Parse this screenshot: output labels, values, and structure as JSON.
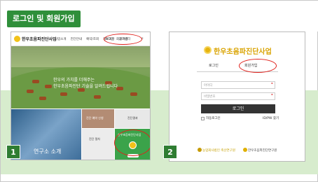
{
  "title": "로그인 및 회원가입",
  "badges": [
    "1",
    "2"
  ],
  "shot1": {
    "logo_text": "한우초음파진단사업",
    "nav": [
      "사업소개",
      "진단안내",
      "예약/조회",
      "정보마당",
      "고객센터"
    ],
    "util_login": "로그인",
    "util_join": "회원가입",
    "hero_line1": "한우의 가치를 더해주는",
    "hero_line2": "한우초음파진단 기술을 알려드립니다",
    "tiles": {
      "lab_label": "연구소 소개",
      "a_label": "진단 예약 신청",
      "b_label": "진단결과",
      "c_label": "진단 절차",
      "d_label": "한우초음파진단사업"
    }
  },
  "shot2": {
    "title": "한우초음파진단사업",
    "tab_login": "로그인",
    "tab_join": "회원가입",
    "id_placeholder": "아이디",
    "pw_placeholder": "비밀번호",
    "login_button": "로그인",
    "auto_login": "자동로그인",
    "find_idpw": "ID/PW 찾기",
    "footer_left": "농업회사법인 축산연구원",
    "footer_right": "한우초음파진단연구원"
  },
  "colors": {
    "accent_green": "#2f8f3a",
    "highlight_red": "#e0201b",
    "brand_yellow": "#d9a300"
  },
  "icons": [
    "search-icon",
    "menu-icon",
    "logo-icon"
  ]
}
